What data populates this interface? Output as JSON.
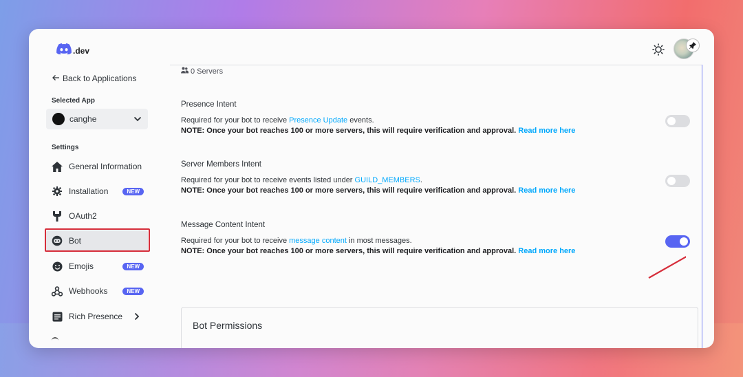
{
  "header": {
    "logo_text": ".dev",
    "logo_icon": "discord-icon",
    "theme_icon": "sun-icon",
    "pin_icon": "pin-icon"
  },
  "sidebar": {
    "back_label": "Back to Applications",
    "selected_app_label": "Selected App",
    "selected_app_name": "canghe",
    "settings_label": "Settings",
    "items": [
      {
        "label": "General Information",
        "icon": "home-icon",
        "badge": ""
      },
      {
        "label": "Installation",
        "icon": "gear-icon",
        "badge": "NEW"
      },
      {
        "label": "OAuth2",
        "icon": "wrench-icon",
        "badge": ""
      },
      {
        "label": "Bot",
        "icon": "bot-icon",
        "badge": ""
      },
      {
        "label": "Emojis",
        "icon": "smile-icon",
        "badge": "NEW"
      },
      {
        "label": "Webhooks",
        "icon": "webhook-icon",
        "badge": "NEW"
      },
      {
        "label": "Rich Presence",
        "icon": "document-icon",
        "badge": ""
      }
    ]
  },
  "main": {
    "servers_label": "0 Servers",
    "intents": [
      {
        "title": "Presence Intent",
        "desc_prefix": "Required for your bot to receive ",
        "desc_link": "Presence Update",
        "desc_suffix": " events.",
        "note": "NOTE: Once your bot reaches 100 or more servers, this will require verification and approval.",
        "read_more": "Read more here",
        "enabled": false
      },
      {
        "title": "Server Members Intent",
        "desc_prefix": "Required for your bot to receive events listed under ",
        "desc_link": "GUILD_MEMBERS",
        "desc_suffix": ".",
        "note": "NOTE: Once your bot reaches 100 or more servers, this will require verification and approval.",
        "read_more": "Read more here",
        "enabled": false
      },
      {
        "title": "Message Content Intent",
        "desc_prefix": "Required for your bot to receive ",
        "desc_link": "message content",
        "desc_suffix": " in most messages.",
        "note": "NOTE: Once your bot reaches 100 or more servers, this will require verification and approval.",
        "read_more": "Read more here",
        "enabled": true
      }
    ],
    "permissions_title": "Bot Permissions"
  },
  "colors": {
    "accent": "#5865f2",
    "link": "#00a8fc",
    "annotation_red": "#d62d3a"
  }
}
